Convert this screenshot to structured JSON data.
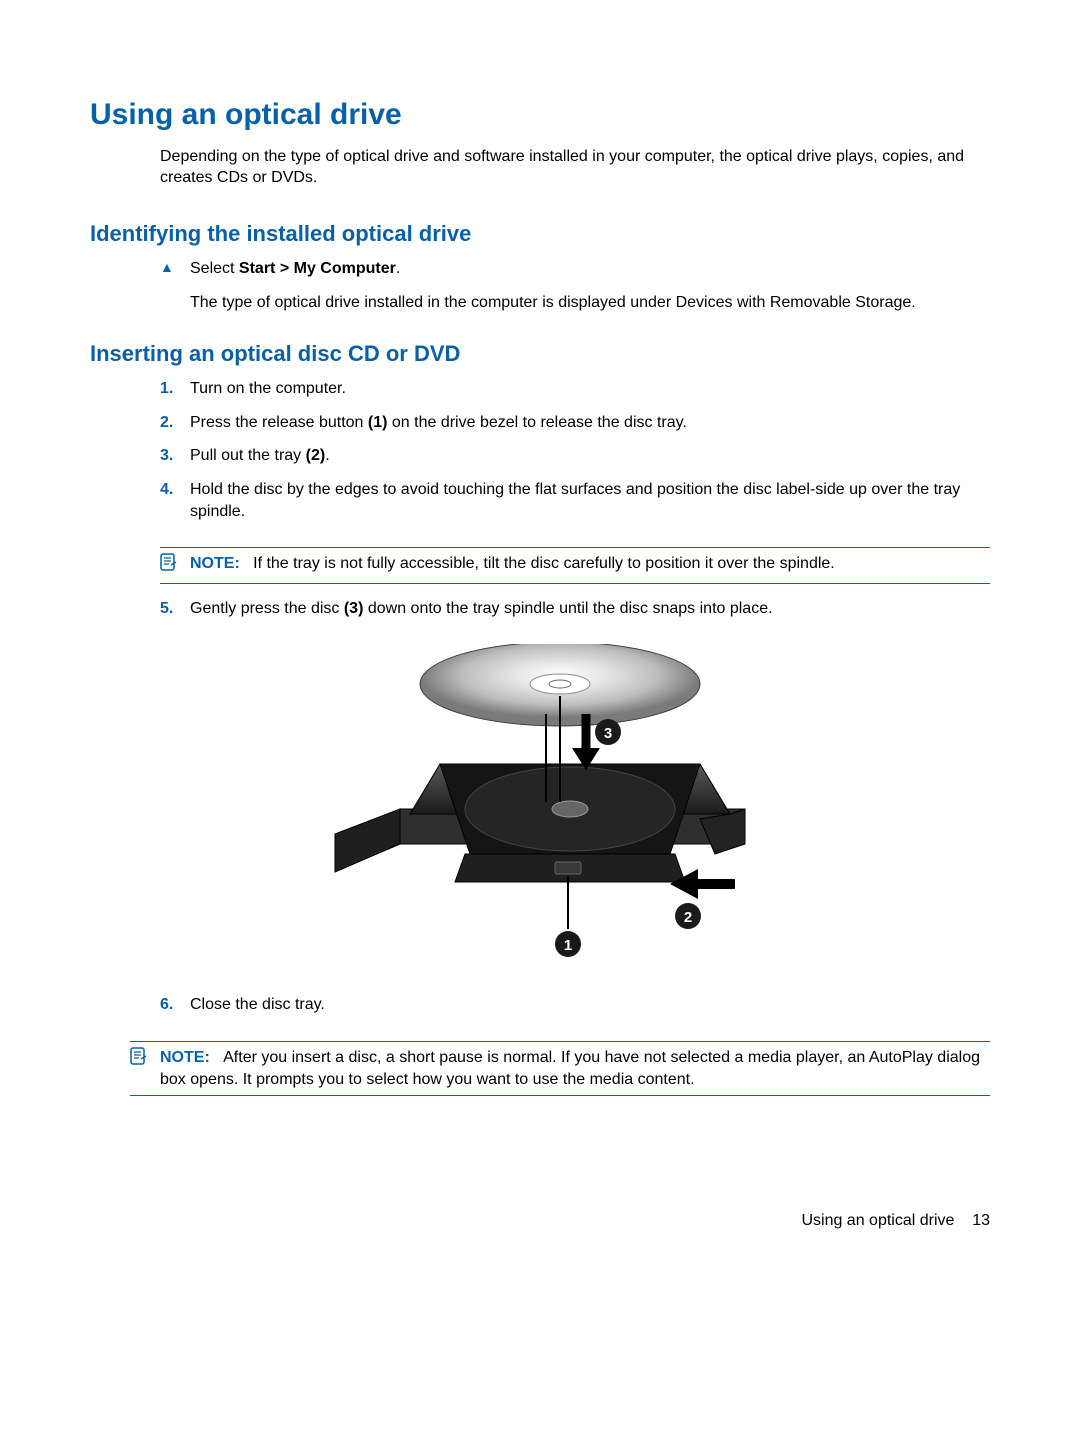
{
  "title": "Using an optical drive",
  "intro": "Depending on the type of optical drive and software installed in your computer, the optical drive plays, copies, and creates CDs or DVDs.",
  "sec1": {
    "heading": "Identifying the installed optical drive",
    "step_prefix": "Select ",
    "step_bold": "Start > My Computer",
    "step_suffix": ".",
    "step_p2": "The type of optical drive installed in the computer is displayed under Devices with Removable Storage."
  },
  "sec2": {
    "heading": "Inserting an optical disc CD or DVD",
    "s1": {
      "n": "1.",
      "t": "Turn on the computer."
    },
    "s2": {
      "n": "2.",
      "a": "Press the release button ",
      "b": "(1)",
      "c": " on the drive bezel to release the disc tray."
    },
    "s3": {
      "n": "3.",
      "a": "Pull out the tray ",
      "b": "(2)",
      "c": "."
    },
    "s4": {
      "n": "4.",
      "t": "Hold the disc by the edges to avoid touching the flat surfaces and position the disc label-side up over the tray spindle."
    },
    "note1": {
      "label": "NOTE:",
      "t": "If the tray is not fully accessible, tilt the disc carefully to position it over the spindle."
    },
    "s5": {
      "n": "5.",
      "a": "Gently press the disc ",
      "b": "(3)",
      "c": " down onto the tray spindle until the disc snaps into place."
    },
    "s6": {
      "n": "6.",
      "t": "Close the disc tray."
    }
  },
  "note2": {
    "label": "NOTE:",
    "t": "After you insert a disc, a short pause is normal. If you have not selected a media player, an AutoPlay dialog box opens. It prompts you to select how you want to use the media content."
  },
  "footer": {
    "title": "Using an optical drive",
    "page": "13"
  },
  "callouts": {
    "c1": "1",
    "c2": "2",
    "c3": "3"
  }
}
